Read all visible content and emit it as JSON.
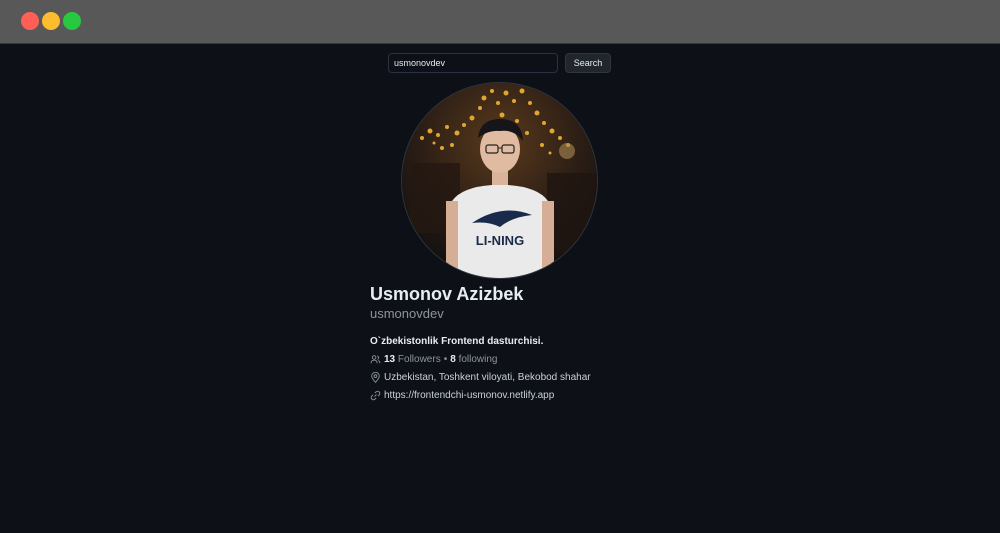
{
  "window": {
    "controls": [
      "close",
      "minimize",
      "maximize"
    ]
  },
  "search": {
    "value": "usmonovdev",
    "button_label": "Search"
  },
  "profile": {
    "name": "Usmonov Azizbek",
    "login": "usmonovdev",
    "bio": "O`zbekistonlik Frontend dasturchisi.",
    "followers_count": "13",
    "followers_label": "Followers",
    "separator": "•",
    "following_count": "8",
    "following_label": "following",
    "location": "Uzbekistan, Toshkent viloyati, Bekobod shahar",
    "website": "https://frontendchi-usmonov.netlify.app",
    "avatar_shirt_text": "LI-NING"
  },
  "icons": {
    "followers": "people-icon",
    "location": "location-pin-icon",
    "website": "link-icon"
  },
  "colors": {
    "background": "#0d1117",
    "titlebar": "#585858",
    "text_primary": "#e6edf3",
    "text_muted": "#8b949e",
    "close": "#ff5f57",
    "minimize": "#febc2e",
    "maximize": "#28c840"
  }
}
